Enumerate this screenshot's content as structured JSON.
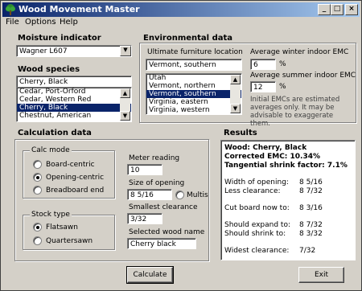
{
  "window": {
    "title": "Wood Movement Master",
    "minimize": "_",
    "maximize": "□",
    "close": "×"
  },
  "menu": [
    "File",
    "Options",
    "Help"
  ],
  "moisture": {
    "heading": "Moisture indicator",
    "value": "Wagner L607"
  },
  "species": {
    "heading": "Wood species",
    "value": "Cherry, Black",
    "items": [
      "Cedar, Port-Orford",
      "Cedar, Western Red",
      "Cherry, Black",
      "Chestnut, American"
    ],
    "selected": 2
  },
  "environment": {
    "heading": "Environmental data",
    "location_label": "Ultimate furniture location",
    "location_value": "Vermont, southern",
    "locations": [
      "Utah",
      "Vermont, northern",
      "Vermont, southern",
      "Virginia, eastern",
      "Virginia, western"
    ],
    "selected": 2,
    "winter_label": "Average winter indoor EMC",
    "winter_value": "6",
    "summer_label": "Average summer indoor EMC",
    "summer_value": "12",
    "percent": "%",
    "note": "Initial EMCs are estimated averages only. It may be advisable to exaggerate them."
  },
  "calc": {
    "heading": "Calculation data",
    "mode_title": "Calc mode",
    "modes": [
      {
        "label": "Board-centric",
        "checked": false
      },
      {
        "label": "Opening-centric",
        "checked": true
      },
      {
        "label": "Breadboard end",
        "checked": false
      }
    ],
    "stock_title": "Stock type",
    "stocks": [
      {
        "label": "Flatsawn",
        "checked": true
      },
      {
        "label": "Quartersawn",
        "checked": false
      }
    ],
    "meter_label": "Meter reading",
    "meter_value": "10",
    "opening_label": "Size of opening",
    "opening_value": "8 5/16",
    "multis_label": "Multis",
    "clearance_label": "Smallest clearance",
    "clearance_value": "3/32",
    "wood_name_label": "Selected wood name",
    "wood_name_value": "Cherry black"
  },
  "results": {
    "heading": "Results",
    "header_lines": [
      "Wood: Cherry, Black",
      "Corrected EMC: 10.34%",
      "Tangential shrink factor: 7.1%"
    ],
    "rows": [
      {
        "label": "Width of opening:",
        "value": "8 5/16"
      },
      {
        "label": "Less clearance:",
        "value": "8 7/32"
      },
      {
        "label": "Cut board now to:",
        "value": "8 3/16"
      },
      {
        "label": "Should expand to:",
        "value": "8 7/32"
      },
      {
        "label": "Should shrink to:",
        "value": "8 3/32"
      },
      {
        "label": "Widest clearance:",
        "value": "7/32"
      }
    ]
  },
  "buttons": {
    "calculate": "Calculate",
    "exit": "Exit"
  }
}
